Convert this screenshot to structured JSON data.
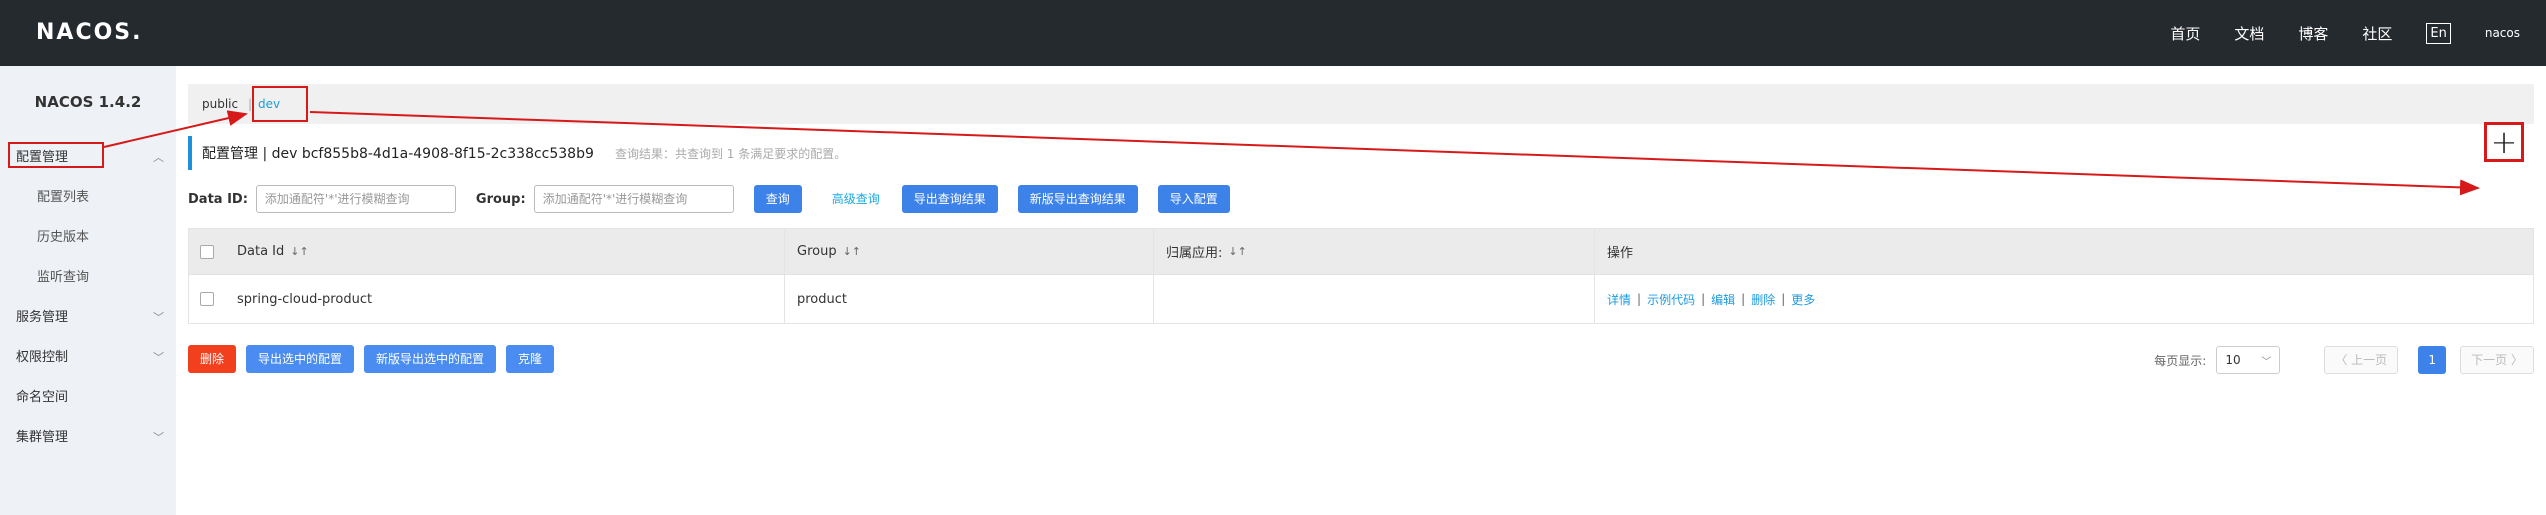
{
  "header": {
    "logo": "NACOS.",
    "nav": [
      "首页",
      "文档",
      "博客",
      "社区"
    ],
    "lang": "En",
    "user": "nacos"
  },
  "sidebar": {
    "version": "NACOS 1.4.2",
    "items": [
      {
        "label": "配置管理",
        "expanded": true
      },
      {
        "label": "配置列表",
        "sub": true
      },
      {
        "label": "历史版本",
        "sub": true
      },
      {
        "label": "监听查询",
        "sub": true
      },
      {
        "label": "服务管理"
      },
      {
        "label": "权限控制"
      },
      {
        "label": "命名空间"
      },
      {
        "label": "集群管理"
      }
    ]
  },
  "namespaces": {
    "public": "public",
    "sep": "|",
    "dev": "dev"
  },
  "title": {
    "main": "配置管理  |  dev  bcf855b8-4d1a-4908-8f15-2c338cc538b9",
    "hint": "查询结果：共查询到 1 条满足要求的配置。"
  },
  "filters": {
    "dataid_label": "Data ID:",
    "dataid_placeholder": "添加通配符'*'进行模糊查询",
    "group_label": "Group:",
    "group_placeholder": "添加通配符'*'进行模糊查询",
    "query": "查询",
    "advanced": "高级查询",
    "export_result": "导出查询结果",
    "new_export_result": "新版导出查询结果",
    "import": "导入配置"
  },
  "add_button": "+",
  "table": {
    "headers": [
      "Data Id",
      "Group",
      "归属应用:",
      "操作"
    ],
    "sort_icon": "↓↑",
    "rows": [
      {
        "data_id": "spring-cloud-product",
        "group": "product",
        "app": ""
      }
    ],
    "ops": [
      "详情",
      "示例代码",
      "编辑",
      "删除",
      "更多"
    ],
    "op_sep": "|"
  },
  "bottom": {
    "delete": "删除",
    "export_selected": "导出选中的配置",
    "new_export_selected": "新版导出选中的配置",
    "clone": "克隆"
  },
  "pager": {
    "page_size_label": "每页显示:",
    "page_size": "10",
    "prev": "〈 上一页",
    "current": "1",
    "next": "下一页 〉"
  },
  "colors": {
    "header_bg": "#252a2f",
    "sidebar_bg": "#eef1f6",
    "primary": "#3d82e8",
    "link": "#1aa8e0",
    "danger": "#f23f1d",
    "annotation": "#d61a1a"
  }
}
